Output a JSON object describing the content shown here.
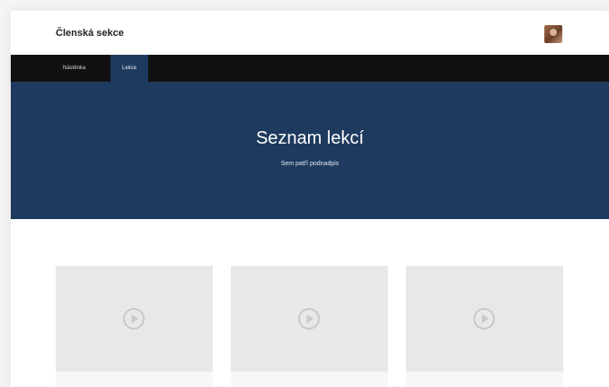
{
  "header": {
    "site_title": "Členská sekce"
  },
  "nav": {
    "items": [
      {
        "label": "Nástěnka",
        "active": false
      },
      {
        "label": "Lekce",
        "active": true
      }
    ]
  },
  "hero": {
    "title": "Seznam lekcí",
    "subtitle": "Sem patří podnadpis"
  },
  "lessons": {
    "cards": [
      {
        "icon": "play-circle-icon"
      },
      {
        "icon": "play-circle-icon"
      },
      {
        "icon": "play-circle-icon"
      }
    ]
  },
  "colors": {
    "primary": "#1f3a5f",
    "navbar": "#111111",
    "card_placeholder": "#e8e8e8"
  }
}
